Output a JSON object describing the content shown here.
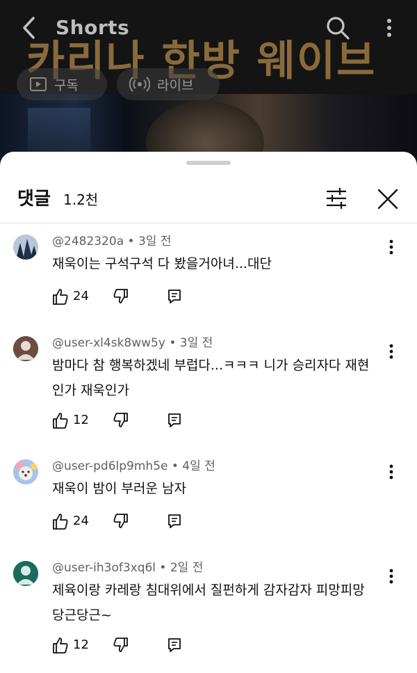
{
  "video": {
    "brand": "Shorts",
    "overlay_title": "카리나 한방 웨이브",
    "chips": {
      "subscribe": "구독",
      "live": "라이브"
    }
  },
  "sheet": {
    "title": "댓글",
    "count": "1.2천"
  },
  "comments": [
    {
      "meta": "@2482320a • 3일 전",
      "text_lines": [
        "재욱이는 구석구석 다 봤을거아녀...대단"
      ],
      "likes": "24"
    },
    {
      "meta": "@user-xl4sk8ww5y • 3일 전",
      "text_lines": [
        "밤마다 참 행복하겠네 부럽다...ㅋㅋㅋ 니가 승리자다 재현",
        "인가 재욱인가"
      ],
      "likes": "12"
    },
    {
      "meta": "@user-pd6lp9mh5e • 4일 전",
      "text_lines": [
        "재욱이 밤이 부러운 남자"
      ],
      "likes": "24"
    },
    {
      "meta": "@user-ih3of3xq6l • 2일 전",
      "text_lines": [
        "제육이랑 카레랑 침대위에서 질펀하게 감자감자 피망피망",
        "당근당근~"
      ],
      "likes": "12"
    }
  ],
  "colors": {
    "overlay_title": "#8a6a3c",
    "meta_text": "#606060",
    "avatar_brown": "#6d4c41",
    "avatar_teal": "#1b6b5a"
  },
  "icons": [
    "back-icon",
    "search-icon",
    "more-vertical-icon",
    "play-icon",
    "live-icon",
    "filter-icon",
    "close-icon",
    "thumbs-up-icon",
    "thumbs-down-icon",
    "reply-icon",
    "person-icon"
  ]
}
